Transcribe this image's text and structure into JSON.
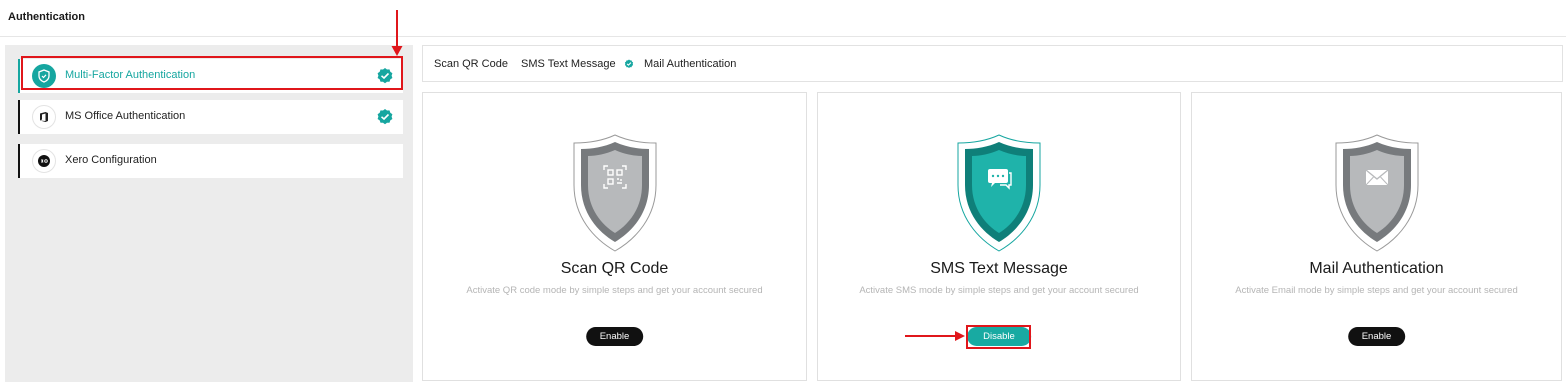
{
  "header": {
    "title": "Authentication"
  },
  "sidebar": {
    "items": [
      {
        "label": "Multi-Factor Authentication",
        "active": true,
        "verified": true,
        "icon": "shield-icon"
      },
      {
        "label": "MS Office Authentication",
        "active": false,
        "verified": true,
        "icon": "office-icon"
      },
      {
        "label": "Xero Configuration",
        "active": false,
        "verified": false,
        "icon": "xero-icon"
      }
    ]
  },
  "tabs": [
    {
      "label": "Scan QR Code",
      "verified": false
    },
    {
      "label": "SMS Text Message",
      "verified": true
    },
    {
      "label": "Mail Authentication",
      "verified": false
    }
  ],
  "cards": [
    {
      "title": "Scan QR Code",
      "description": "Activate QR code mode by simple steps and get your account secured",
      "button": "Enable",
      "state": "disabled",
      "icon": "qr-code-icon"
    },
    {
      "title": "SMS Text Message",
      "description": "Activate SMS mode by simple steps and get your account secured",
      "button": "Disable",
      "state": "enabled",
      "icon": "chat-icon"
    },
    {
      "title": "Mail Authentication",
      "description": "Activate Email mode by simple steps and get your account secured",
      "button": "Enable",
      "state": "disabled",
      "icon": "mail-icon"
    }
  ],
  "colors": {
    "accent": "#16a6a0",
    "annotation": "#e0161b",
    "inactive_shield": "#8a8a8a"
  }
}
